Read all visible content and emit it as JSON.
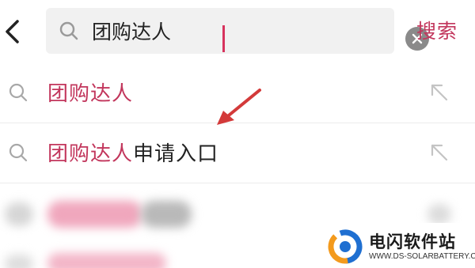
{
  "search": {
    "query": "团购达人",
    "search_label": "搜索"
  },
  "suggestions": [
    {
      "highlight": "团购达人",
      "rest": ""
    },
    {
      "highlight": "团购达人",
      "rest": "申请入口"
    }
  ],
  "watermark": {
    "title": "电闪软件站",
    "subtitle": "WWW.DS-SOLARBATTERY.COM"
  },
  "colors": {
    "accent": "#c2365c",
    "annotation_arrow": "#d33a3a"
  },
  "icons": {
    "back": "chevron-left-icon",
    "search": "search-icon",
    "clear": "clear-icon",
    "fill": "arrow-up-left-icon"
  }
}
